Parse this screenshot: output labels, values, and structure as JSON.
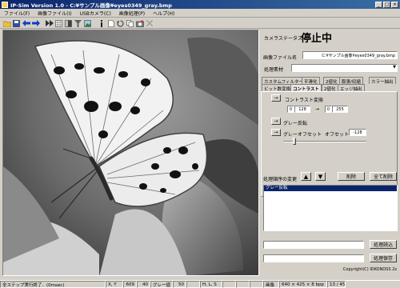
{
  "window": {
    "title": "IP-Sim Version 1.0  -  C:¥サンプル画像¥eyes0349_gray.bmp",
    "min": "_",
    "max": "□",
    "close": "×"
  },
  "menu": [
    "ファイル(F)",
    "画像ファイル(I)",
    "USBカメラ(C)",
    "画像処理(P)",
    "ヘルプ(H)"
  ],
  "status_panel": {
    "caption": "カメラステータス",
    "state": "停止中",
    "file_label": "画像ファイル名",
    "file_value": "C:¥サンプル画像¥eyes0349_gray.bmp",
    "mode_label": "処理素材",
    "mode_value": ""
  },
  "tabs": {
    "row1": [
      "カスタムフィルター",
      "平滑化",
      "2値化",
      "膨張/収縮",
      "カラー抽出"
    ],
    "row2": [
      "ビット数変換",
      "コントラスト",
      "2値化",
      "エッジ抽出"
    ]
  },
  "contrast": {
    "apply_button": "→",
    "title": "コントラスト変換",
    "in_min": "0",
    "in_max": "128",
    "arrow": "→",
    "out_min": "0",
    "out_max": "255",
    "gray_button": "→",
    "gray_label": "グレー反転",
    "offset_button": "→",
    "offset_label": "グレーオフセット",
    "offset_caption": "オフセット",
    "offset_value": "-128"
  },
  "sequence": {
    "label": "処理順序の変更",
    "up": "▲",
    "down": "▼",
    "delete": "削除",
    "delete_all": "全て削除",
    "items": [
      "グレー反転"
    ]
  },
  "file_rows": {
    "load_button": "処理読込",
    "save_button": "処理保存"
  },
  "copyright": "Copyright(C) IDKONOSS 2s",
  "statusbar": {
    "message": "全ステップ実行終了．(0msec)",
    "xy_label": "X, Y",
    "x": "609",
    "y": "40",
    "gray_label": "グレー値",
    "gray": "50",
    "hls_label": "H, L, S",
    "size_label": "画像",
    "size": "640 × 425 × 8 bpp",
    "page": "13 / 45"
  }
}
